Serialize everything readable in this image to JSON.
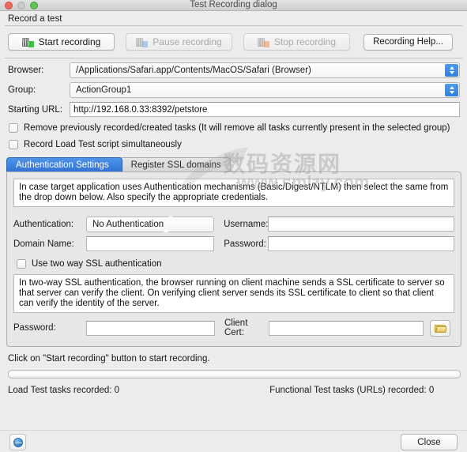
{
  "window": {
    "title": "Test Recording dialog",
    "traffic_lights": [
      "close-button",
      "minimize-button",
      "zoom-button"
    ]
  },
  "record_section": {
    "label": "Record a test",
    "buttons": [
      {
        "label": "Start recording",
        "icon": "record-start-icon",
        "enabled": true
      },
      {
        "label": "Pause recording",
        "icon": "record-pause-icon",
        "enabled": false
      },
      {
        "label": "Stop recording",
        "icon": "record-stop-icon",
        "enabled": false
      }
    ],
    "help_button": "Recording Help..."
  },
  "fields": {
    "browser_label": "Browser:",
    "browser_value": "/Applications/Safari.app/Contents/MacOS/Safari (Browser)",
    "group_label": "Group:",
    "group_value": "ActionGroup1",
    "url_label": "Starting URL:",
    "url_value": "http://192.168.0.33:8392/petstore"
  },
  "checkboxes": [
    {
      "label": "Remove previously recorded/created tasks (It will remove all tasks currently present in the selected group)",
      "checked": false
    },
    {
      "label": "Record Load Test script simultaneously",
      "checked": false
    }
  ],
  "tabs": [
    {
      "label": "Authentication Settings",
      "active": true
    },
    {
      "label": "Register SSL domains",
      "active": false
    }
  ],
  "auth_panel": {
    "info": "In case target application uses Authentication mechanisms (Basic/Digest/NTLM) then select the same from the drop down below. Also specify the appropriate credentials.",
    "authentication_label": "Authentication:",
    "authentication_value": "No Authentication",
    "username_label": "Username:",
    "username_value": "",
    "domain_label": "Domain Name:",
    "domain_value": "",
    "password_label": "Password:",
    "password_value": "",
    "ssl_checkbox": {
      "label": "Use two way SSL authentication",
      "checked": false
    },
    "ssl_info": "In two-way SSL authentication, the browser running on client machine sends a SSL certificate to server so that server can verify the client. On verifying client server sends its SSL certificate to client so that client can verify the identity of the server.",
    "cert_password_label": "Password:",
    "cert_password_value": "",
    "client_cert_label": "Client Cert:",
    "client_cert_value": "",
    "browse_icon": "folder-icon"
  },
  "status": {
    "message": "Click on \"Start recording\" button to start recording.",
    "progress_percent": 0,
    "load_test_counter": "Load Test tasks recorded: 0",
    "functional_test_counter": "Functional Test tasks (URLs) recorded: 0"
  },
  "footer": {
    "help_icon": "help-icon",
    "close_label": "Close"
  },
  "watermark": {
    "chinese": "数码资源网",
    "url": "www.smlzy.com"
  },
  "colors": {
    "accent_blue": "#2f72d6",
    "window_bg": "#ececec",
    "panel_bg": "#e7e7e7",
    "start_green": "#3fbf3f",
    "stop_orange": "#f08a5a"
  }
}
